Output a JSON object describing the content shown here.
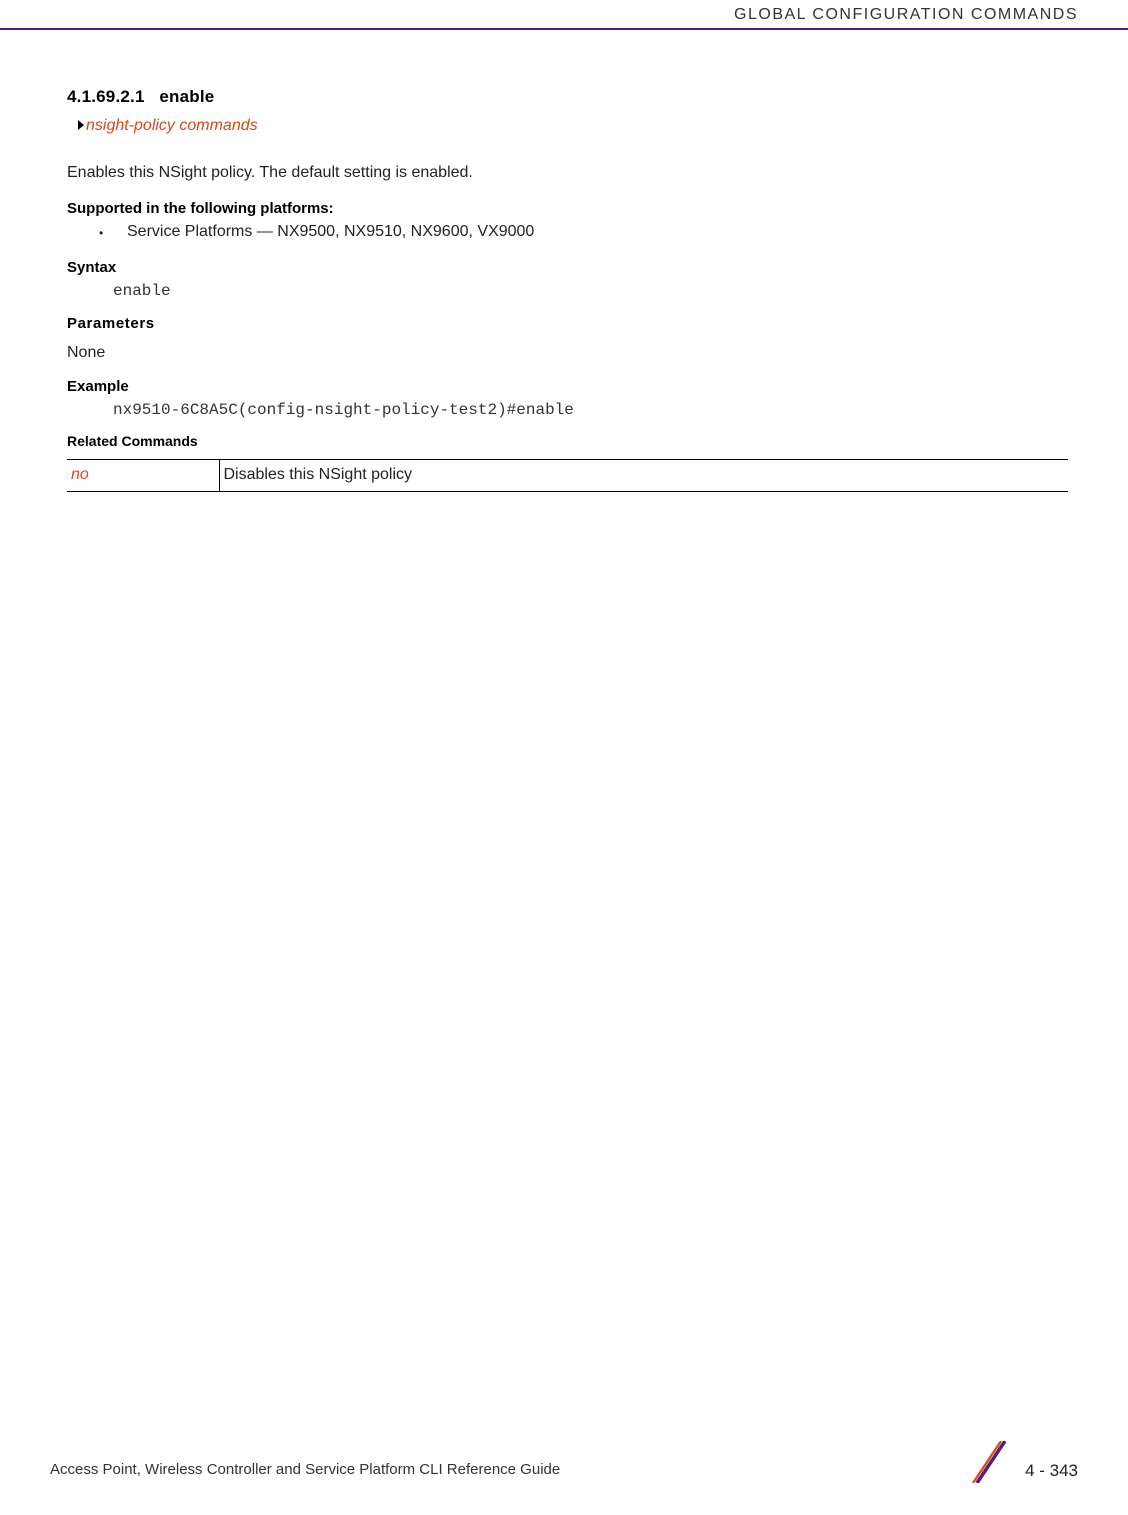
{
  "running_header": "GLOBAL CONFIGURATION COMMANDS",
  "section": {
    "number": "4.1.69.2.1",
    "title": "enable",
    "crumb_link": "nsight-policy commands"
  },
  "description": "Enables this NSight policy. The default setting is enabled.",
  "platforms": {
    "heading": "Supported in the following platforms:",
    "items": [
      "Service Platforms — NX9500, NX9510, NX9600, VX9000"
    ]
  },
  "syntax": {
    "heading": "Syntax",
    "code": "enable"
  },
  "parameters": {
    "heading": "Parameters",
    "value": "None"
  },
  "example": {
    "heading": "Example",
    "code": "nx9510-6C8A5C(config-nsight-policy-test2)#enable"
  },
  "related": {
    "heading": "Related Commands",
    "rows": [
      {
        "cmd": "no",
        "desc": "Disables this NSight policy"
      }
    ]
  },
  "footer": {
    "guide": "Access Point, Wireless Controller and Service Platform CLI Reference Guide",
    "page": "4 - 343"
  }
}
